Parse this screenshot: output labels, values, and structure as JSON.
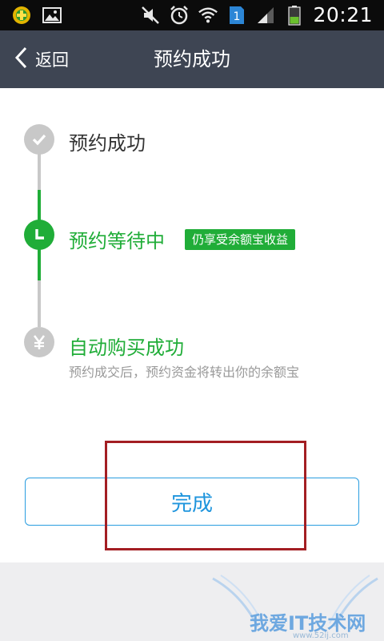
{
  "status_bar": {
    "time": "20:21",
    "sim_badge": "1",
    "icons": [
      "app-notification-icon",
      "image-notification-icon",
      "mute-icon",
      "alarm-icon",
      "wifi-icon",
      "sim-1-icon",
      "signal-icon",
      "battery-icon"
    ]
  },
  "header": {
    "back_label": "返回",
    "title": "预约成功"
  },
  "timeline": {
    "steps": [
      {
        "title": "预约成功",
        "icon": "check-icon",
        "status": "completed"
      },
      {
        "title": "预约等待中",
        "icon": "clock-icon",
        "status": "current",
        "badge": "仍享受余额宝收益"
      },
      {
        "title": "自动购买成功",
        "icon": "yuan-icon",
        "status": "pending",
        "description": "预约成交后，预约资金将转出你的余额宝"
      }
    ]
  },
  "actions": {
    "done_label": "完成"
  },
  "watermark": {
    "text": "我爱IT技术网",
    "url": "www.52ij.com"
  },
  "colors": {
    "header_bg": "#3e4553",
    "green": "#20ad38",
    "gray_node": "#c8c8c8",
    "blue": "#1f95dd",
    "highlight": "#a31e23"
  }
}
